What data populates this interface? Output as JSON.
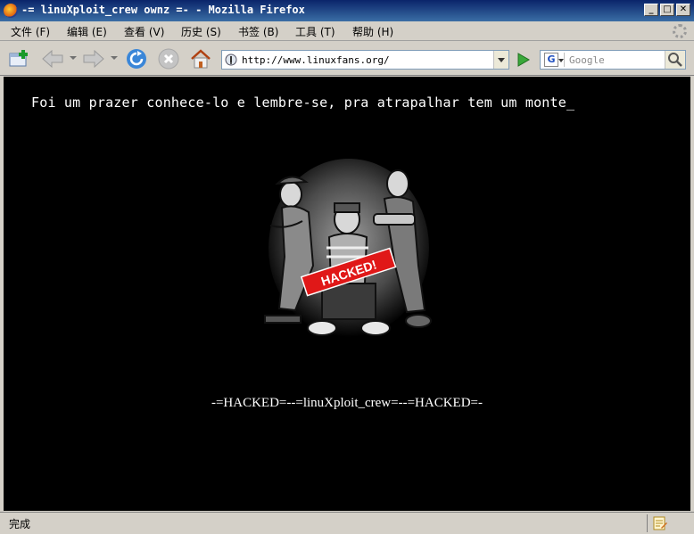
{
  "window": {
    "title": "-= linuXploit_crew ownz =- - Mozilla Firefox",
    "buttons": [
      "minimize",
      "maximize",
      "close"
    ]
  },
  "menubar": {
    "items": [
      {
        "label": "文件 (F)"
      },
      {
        "label": "编辑 (E)"
      },
      {
        "label": "查看 (V)"
      },
      {
        "label": "历史 (S)"
      },
      {
        "label": "书签 (B)"
      },
      {
        "label": "工具 (T)"
      },
      {
        "label": "帮助 (H)"
      }
    ]
  },
  "toolbar": {
    "icons": [
      "new-tab-icon",
      "back-icon",
      "forward-icon",
      "reload-icon",
      "stop-icon",
      "home-icon",
      "go-icon"
    ],
    "url": "http://www.linuxfans.org/",
    "search_placeholder": "Google"
  },
  "page": {
    "message": "Foi um prazer conhece-lo e lembre-se, pra atrapalhar tem um monte_",
    "image_label": "HACKED!",
    "crew_line": "-=HACKED=--=linuXploit_crew=--=HACKED=-",
    "background": "#000000",
    "text_color": "#ffffff"
  },
  "statusbar": {
    "text": "完成"
  },
  "colors": {
    "titlebar": "#0a246a",
    "chrome": "#d4d0c8",
    "banner_red": "#e01818"
  }
}
